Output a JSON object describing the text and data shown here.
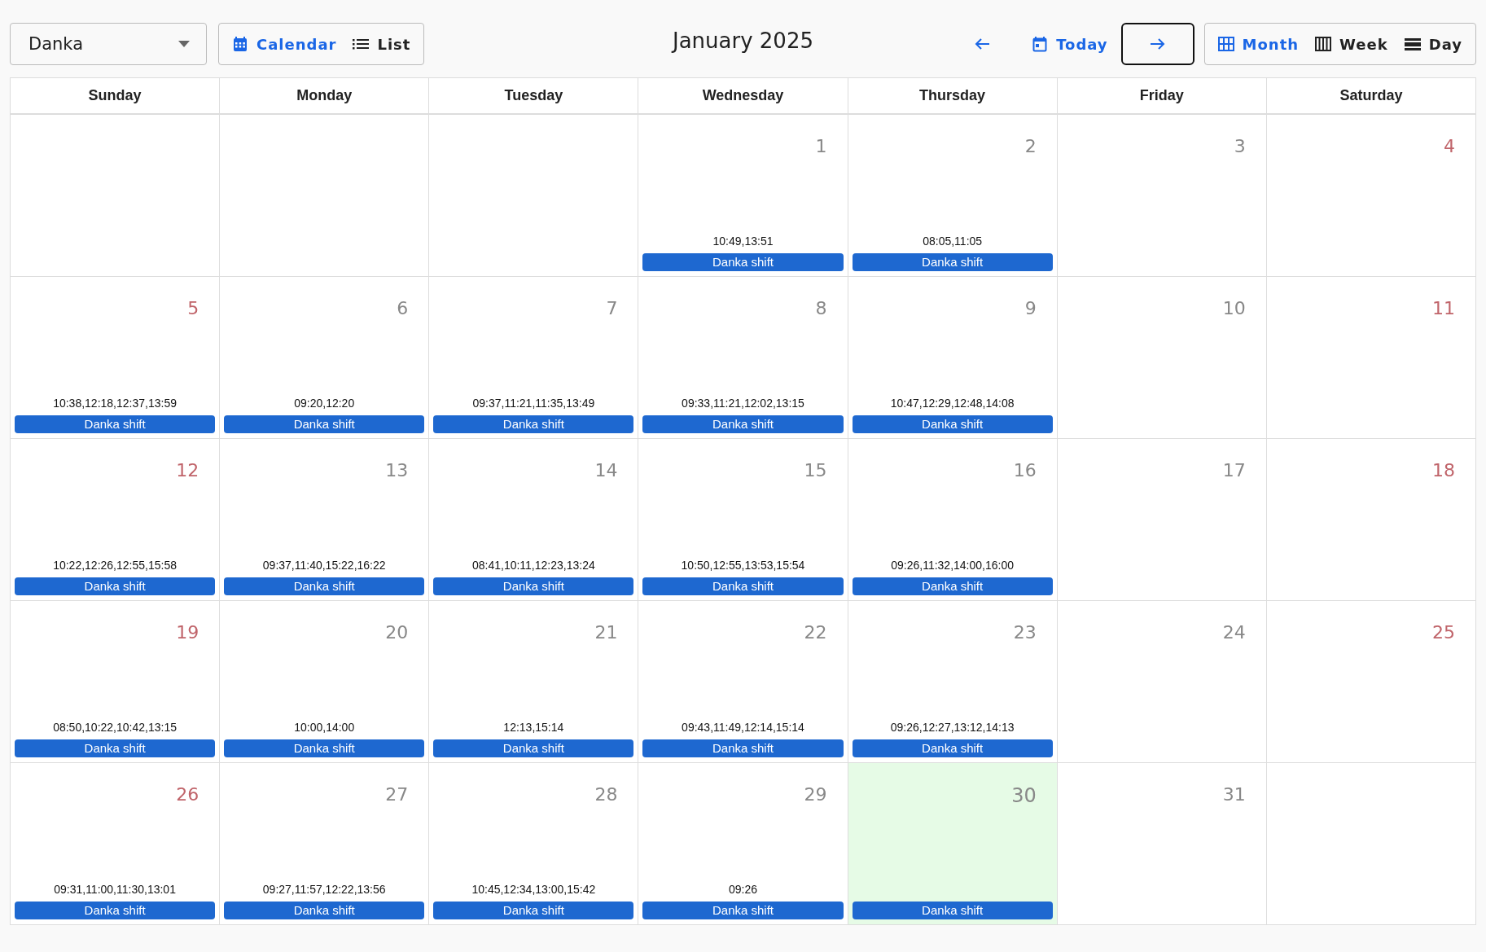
{
  "toolbar": {
    "person_select": {
      "value": "Danka"
    },
    "view_toggle": [
      {
        "kind": "calendar",
        "label": "Calendar",
        "selected": true
      },
      {
        "kind": "list",
        "label": "List",
        "selected": false
      }
    ],
    "title": "January 2025",
    "navigation": {
      "today_label": "Today",
      "next_focused": true
    },
    "range_toggle": [
      {
        "kind": "month",
        "label": "Month",
        "selected": true
      },
      {
        "kind": "week",
        "label": "Week",
        "selected": false
      },
      {
        "kind": "day",
        "label": "Day",
        "selected": false
      }
    ]
  },
  "calendar": {
    "weekdays": [
      "Sunday",
      "Monday",
      "Tuesday",
      "Wednesday",
      "Thursday",
      "Friday",
      "Saturday"
    ],
    "weeks": [
      [
        {
          "kind": "blank"
        },
        {
          "kind": "blank"
        },
        {
          "kind": "blank"
        },
        {
          "kind": "day",
          "day": "1",
          "weekend": false,
          "today": false,
          "times": "10:49,13:51",
          "event": "Danka shift"
        },
        {
          "kind": "day",
          "day": "2",
          "weekend": false,
          "today": false,
          "times": "08:05,11:05",
          "event": "Danka shift"
        },
        {
          "kind": "day",
          "day": "3",
          "weekend": false,
          "today": false
        },
        {
          "kind": "day",
          "day": "4",
          "weekend": true,
          "today": false
        }
      ],
      [
        {
          "kind": "day",
          "day": "5",
          "weekend": true,
          "today": false,
          "times": "10:38,12:18,12:37,13:59",
          "event": "Danka shift"
        },
        {
          "kind": "day",
          "day": "6",
          "weekend": false,
          "today": false,
          "times": "09:20,12:20",
          "event": "Danka shift"
        },
        {
          "kind": "day",
          "day": "7",
          "weekend": false,
          "today": false,
          "times": "09:37,11:21,11:35,13:49",
          "event": "Danka shift"
        },
        {
          "kind": "day",
          "day": "8",
          "weekend": false,
          "today": false,
          "times": "09:33,11:21,12:02,13:15",
          "event": "Danka shift"
        },
        {
          "kind": "day",
          "day": "9",
          "weekend": false,
          "today": false,
          "times": "10:47,12:29,12:48,14:08",
          "event": "Danka shift"
        },
        {
          "kind": "day",
          "day": "10",
          "weekend": false,
          "today": false
        },
        {
          "kind": "day",
          "day": "11",
          "weekend": true,
          "today": false
        }
      ],
      [
        {
          "kind": "day",
          "day": "12",
          "weekend": true,
          "today": false,
          "times": "10:22,12:26,12:55,15:58",
          "event": "Danka shift"
        },
        {
          "kind": "day",
          "day": "13",
          "weekend": false,
          "today": false,
          "times": "09:37,11:40,15:22,16:22",
          "event": "Danka shift"
        },
        {
          "kind": "day",
          "day": "14",
          "weekend": false,
          "today": false,
          "times": "08:41,10:11,12:23,13:24",
          "event": "Danka shift"
        },
        {
          "kind": "day",
          "day": "15",
          "weekend": false,
          "today": false,
          "times": "10:50,12:55,13:53,15:54",
          "event": "Danka shift"
        },
        {
          "kind": "day",
          "day": "16",
          "weekend": false,
          "today": false,
          "times": "09:26,11:32,14:00,16:00",
          "event": "Danka shift"
        },
        {
          "kind": "day",
          "day": "17",
          "weekend": false,
          "today": false
        },
        {
          "kind": "day",
          "day": "18",
          "weekend": true,
          "today": false
        }
      ],
      [
        {
          "kind": "day",
          "day": "19",
          "weekend": true,
          "today": false,
          "times": "08:50,10:22,10:42,13:15",
          "event": "Danka shift"
        },
        {
          "kind": "day",
          "day": "20",
          "weekend": false,
          "today": false,
          "times": "10:00,14:00",
          "event": "Danka shift"
        },
        {
          "kind": "day",
          "day": "21",
          "weekend": false,
          "today": false,
          "times": "12:13,15:14",
          "event": "Danka shift"
        },
        {
          "kind": "day",
          "day": "22",
          "weekend": false,
          "today": false,
          "times": "09:43,11:49,12:14,15:14",
          "event": "Danka shift"
        },
        {
          "kind": "day",
          "day": "23",
          "weekend": false,
          "today": false,
          "times": "09:26,12:27,13:12,14:13",
          "event": "Danka shift"
        },
        {
          "kind": "day",
          "day": "24",
          "weekend": false,
          "today": false
        },
        {
          "kind": "day",
          "day": "25",
          "weekend": true,
          "today": false
        }
      ],
      [
        {
          "kind": "day",
          "day": "26",
          "weekend": true,
          "today": false,
          "times": "09:31,11:00,11:30,13:01",
          "event": "Danka shift"
        },
        {
          "kind": "day",
          "day": "27",
          "weekend": false,
          "today": false,
          "times": "09:27,11:57,12:22,13:56",
          "event": "Danka shift"
        },
        {
          "kind": "day",
          "day": "28",
          "weekend": false,
          "today": false,
          "times": "10:45,12:34,13:00,15:42",
          "event": "Danka shift"
        },
        {
          "kind": "day",
          "day": "29",
          "weekend": false,
          "today": false,
          "times": "09:26",
          "event": "Danka shift"
        },
        {
          "kind": "day",
          "day": "30",
          "weekend": false,
          "today": true,
          "event": "Danka shift"
        },
        {
          "kind": "day",
          "day": "31",
          "weekend": false,
          "today": false
        },
        {
          "kind": "blank"
        }
      ]
    ]
  }
}
